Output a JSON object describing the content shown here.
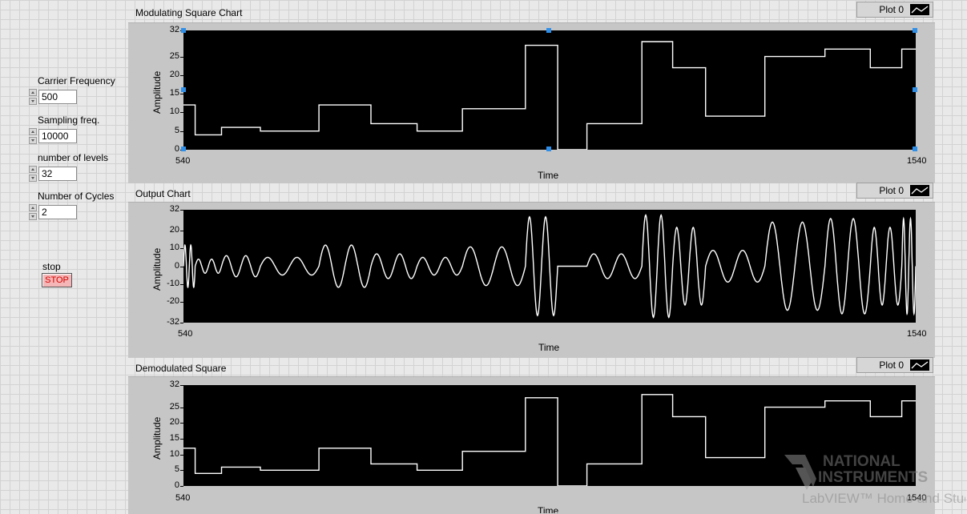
{
  "controls": {
    "carrier_frequency": {
      "label": "Carrier Frequency",
      "value": "500"
    },
    "sampling_freq": {
      "label": "Sampling freq.",
      "value": "10000"
    },
    "number_of_levels": {
      "label": "number of levels",
      "value": "32"
    },
    "number_of_cycles": {
      "label": "Number of Cycles",
      "value": "2"
    },
    "stop": {
      "label": "stop",
      "button_text": "STOP"
    }
  },
  "charts": {
    "modulating": {
      "title": "Modulating Square Chart",
      "legend": "Plot 0",
      "ylabel": "Amplitude",
      "xlabel": "Time",
      "x_min": "540",
      "x_max": "1540"
    },
    "output": {
      "title": "Output Chart",
      "legend": "Plot 0",
      "ylabel": "Amplitude",
      "xlabel": "Time",
      "x_min": "540",
      "x_max": "1540"
    },
    "demodulated": {
      "title": "Demodulated Square",
      "legend": "Plot 0",
      "ylabel": "Amplitude",
      "xlabel": "Time",
      "x_min": "540",
      "x_max": "1540"
    }
  },
  "watermark": {
    "line1": "NATIONAL",
    "line2": "INSTRUMENTS",
    "line3": "LabVIEW™ Home and Student"
  },
  "colors": {
    "plot_bg": "#000000",
    "trace": "#ffffff",
    "panel": "#c6c6c6",
    "stop_text": "#d10000",
    "selection_handle": "#2f8fe8"
  },
  "chart_data": [
    {
      "type": "line",
      "title": "Modulating Square Chart",
      "xlabel": "Time",
      "ylabel": "Amplitude",
      "xlim": [
        540,
        1540
      ],
      "ylim": [
        0,
        32
      ],
      "yticks": [
        0,
        5,
        10,
        15,
        20,
        25,
        32
      ],
      "step": true,
      "series": [
        {
          "name": "Plot 0",
          "x": [
            540,
            556,
            592,
            645,
            725,
            796,
            859,
            921,
            1007,
            1051,
            1091,
            1166,
            1208,
            1253,
            1334,
            1416,
            1478,
            1521,
            1540
          ],
          "values": [
            12,
            4,
            6,
            5,
            12,
            7,
            5,
            11,
            28,
            0,
            7,
            29,
            22,
            9,
            25,
            27,
            22,
            27,
            3
          ]
        }
      ]
    },
    {
      "type": "line",
      "title": "Output Chart",
      "xlabel": "Time",
      "ylabel": "Amplitude",
      "xlim": [
        540,
        1540
      ],
      "ylim": [
        -32,
        32
      ],
      "yticks": [
        -32,
        -20,
        -10,
        0,
        10,
        20,
        32
      ],
      "carrier_cycles_per_segment": 2,
      "series": [
        {
          "name": "Plot 0",
          "x": [
            540,
            556,
            592,
            645,
            725,
            796,
            859,
            921,
            1007,
            1051,
            1091,
            1166,
            1208,
            1253,
            1334,
            1416,
            1478,
            1521,
            1540
          ],
          "values": [
            12,
            4,
            6,
            5,
            12,
            7,
            5,
            11,
            28,
            0,
            7,
            29,
            22,
            9,
            25,
            27,
            22,
            27,
            3
          ]
        }
      ]
    },
    {
      "type": "line",
      "title": "Demodulated Square",
      "xlabel": "Time",
      "ylabel": "Amplitude",
      "xlim": [
        540,
        1540
      ],
      "ylim": [
        0,
        32
      ],
      "yticks": [
        0,
        5,
        10,
        15,
        20,
        25,
        32
      ],
      "step": true,
      "series": [
        {
          "name": "Plot 0",
          "x": [
            540,
            556,
            592,
            645,
            725,
            796,
            859,
            921,
            1007,
            1051,
            1091,
            1166,
            1208,
            1253,
            1334,
            1416,
            1478,
            1521,
            1540
          ],
          "values": [
            12,
            4,
            6,
            5,
            12,
            7,
            5,
            11,
            28,
            0,
            7,
            29,
            22,
            9,
            25,
            27,
            22,
            27,
            3
          ]
        }
      ]
    }
  ]
}
